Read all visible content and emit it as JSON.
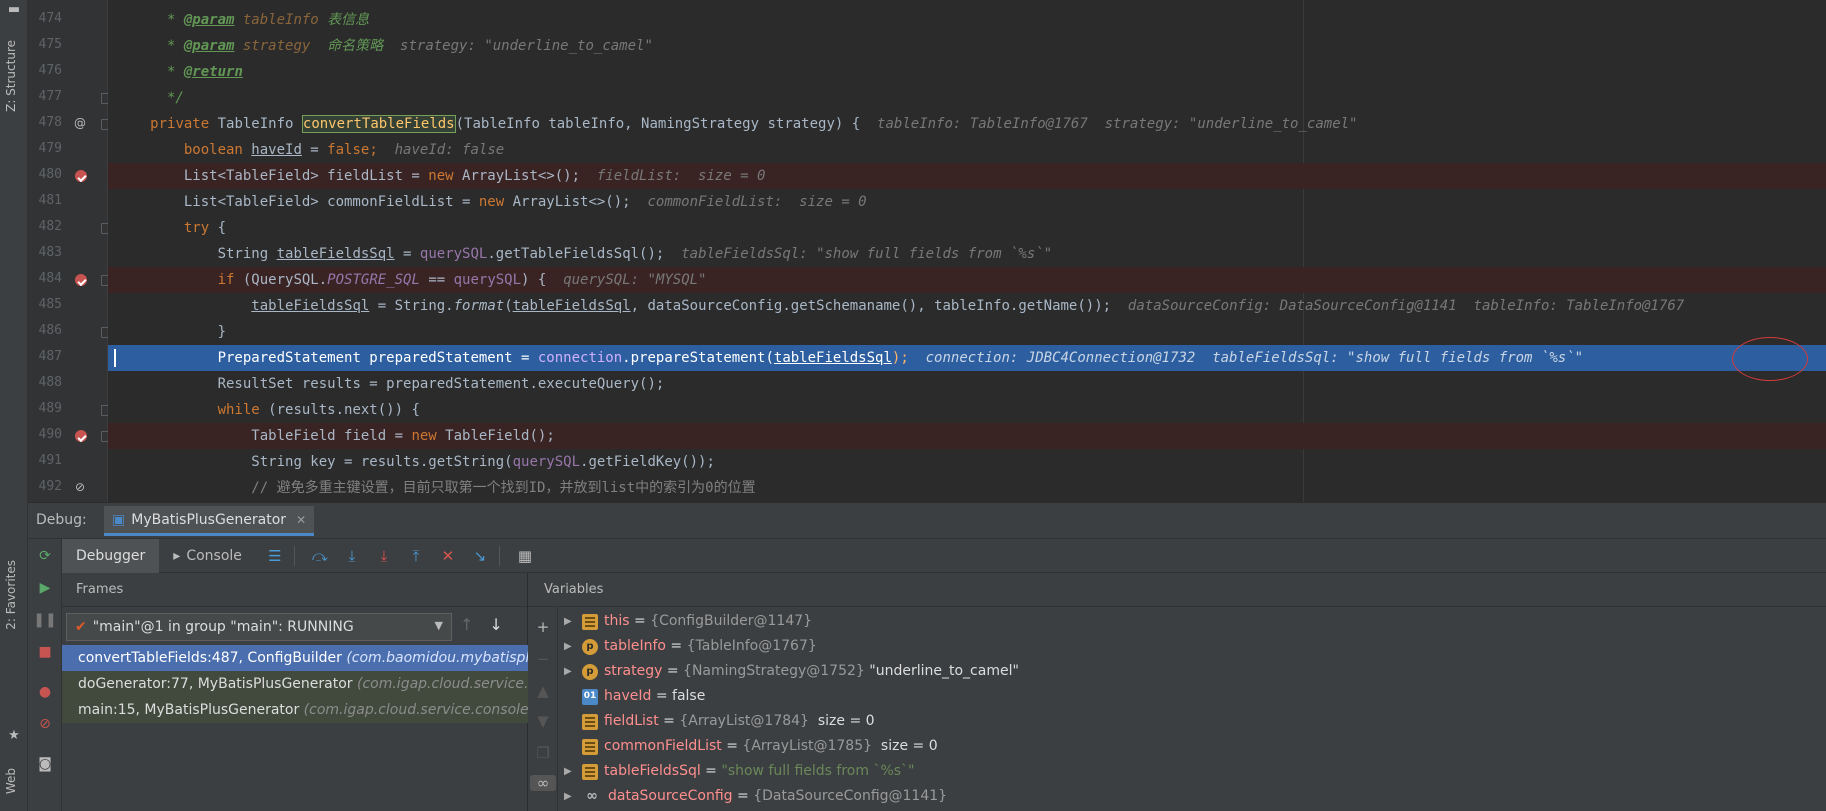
{
  "sidebar": {
    "tabs": [
      "Z: Structure",
      "2: Favorites",
      "Web"
    ]
  },
  "editor": {
    "lines": [
      {
        "n": "474",
        "marker": "",
        "fold": false
      },
      {
        "n": "475",
        "marker": "",
        "fold": false
      },
      {
        "n": "476",
        "marker": "",
        "fold": false
      },
      {
        "n": "477",
        "marker": "",
        "fold": true
      },
      {
        "n": "478",
        "marker": "@",
        "fold": true
      },
      {
        "n": "479",
        "marker": "",
        "fold": false
      },
      {
        "n": "480",
        "marker": "breakpoint",
        "fold": false
      },
      {
        "n": "481",
        "marker": "",
        "fold": false
      },
      {
        "n": "482",
        "marker": "",
        "fold": true
      },
      {
        "n": "483",
        "marker": "",
        "fold": false
      },
      {
        "n": "484",
        "marker": "breakpoint",
        "fold": true
      },
      {
        "n": "485",
        "marker": "",
        "fold": false
      },
      {
        "n": "486",
        "marker": "",
        "fold": true
      },
      {
        "n": "487",
        "marker": "",
        "fold": false
      },
      {
        "n": "488",
        "marker": "",
        "fold": false
      },
      {
        "n": "489",
        "marker": "",
        "fold": true
      },
      {
        "n": "490",
        "marker": "breakpoint",
        "fold": true
      },
      {
        "n": "491",
        "marker": "",
        "fold": false
      },
      {
        "n": "492",
        "marker": "disabled",
        "fold": false
      }
    ],
    "code": {
      "l474": {
        "star": " * ",
        "tag": "@param",
        "param": " tableInfo",
        "text": " 表信息"
      },
      "l475": {
        "star": " * ",
        "tag": "@param",
        "param": " strategy",
        "text": "  命名策略",
        "hint": "  strategy: \"underline_to_camel\""
      },
      "l476": {
        "star": " * ",
        "tag": "@return"
      },
      "l477": {
        "text": " */"
      },
      "l478": {
        "kw": "private ",
        "t1": "TableInfo ",
        "fn": "convertTableFields",
        "rest": "(TableInfo tableInfo, NamingStrategy strategy) {",
        "hint": "  tableInfo: TableInfo@1767  strategy: \"underline_to_camel\""
      },
      "l479": {
        "kw": "boolean ",
        "var": "haveId",
        "rest1": " = ",
        "kw2": "false",
        "rest2": ";",
        "hint": "  haveId: false"
      },
      "l480": {
        "t1": "List<TableField> fieldList = ",
        "kw": "new ",
        "rest": "ArrayList<>();",
        "hint": "  fieldList:  size = 0"
      },
      "l481": {
        "t1": "List<TableField> commonFieldList = ",
        "kw": "new ",
        "rest": "ArrayList<>();",
        "hint": "  commonFieldList:  size = 0"
      },
      "l482": {
        "kw": "try ",
        "rest": "{"
      },
      "l483": {
        "t1": "String ",
        "var": "tableFieldsSql",
        "rest1": " = ",
        "st": "querySQL",
        "rest2": ".getTableFieldsSql();",
        "hint": "  tableFieldsSql: \"show full fields from `%s`\""
      },
      "l484": {
        "kw": "if ",
        "t1": "(QuerySQL.",
        "st": "POSTGRE_SQL",
        "rest1": " == ",
        "st2": "querySQL",
        "rest2": ") {",
        "hint": "  querySQL: \"MYSQL\""
      },
      "l485": {
        "var": "tableFieldsSql",
        "rest1": " = String.",
        "it": "format",
        "rest2": "(",
        "var2": "tableFieldsSql",
        "rest3": ", dataSourceConfig.getSchemaname(), tableInfo.getName());",
        "hint": "  dataSourceConfig: DataSourceConfig@1141  tableInfo: TableInfo@1767"
      },
      "l486": {
        "text": "}"
      },
      "l487": {
        "t1": "PreparedStatement preparedStatement = ",
        "st": "connection",
        "rest1": ".prepareStatement(",
        "var": "tableFieldsSql",
        "rest2": ");",
        "hint": "  connection: JDBC4Connection@1732  tableFieldsSql: \"show full fields from `%s`\""
      },
      "l488": {
        "text": "ResultSet results = preparedStatement.executeQuery();"
      },
      "l489": {
        "kw": "while ",
        "rest": "(results.next()) {"
      },
      "l490": {
        "t1": "TableField field = ",
        "kw": "new ",
        "rest": "TableField();"
      },
      "l491": {
        "t1": "String key = results.getString(",
        "st": "querySQL",
        "rest": ".getFieldKey());"
      },
      "l492": {
        "text": "// 避免多重主键设置，目前只取第一个找到ID，并放到list中的索引为0的位置"
      }
    }
  },
  "debug": {
    "title": "Debug:",
    "session_tab": "MyBatisPlusGenerator",
    "tabs": {
      "debugger": "Debugger",
      "console": "Console"
    },
    "frames": {
      "header": "Frames",
      "thread": "\"main\"@1 in group \"main\": RUNNING",
      "items": [
        {
          "method": "convertTableFields:487, ConfigBuilder",
          "pkg": " (com.baomidou.mybatisplus"
        },
        {
          "method": "doGenerator:77, MyBatisPlusGenerator",
          "pkg": " (com.igap.cloud.service.cons"
        },
        {
          "method": "main:15, MyBatisPlusGenerator",
          "pkg": " (com.igap.cloud.service.console)"
        }
      ]
    },
    "variables": {
      "header": "Variables",
      "items": [
        {
          "icon": "field",
          "expand": true,
          "name": "this",
          "eq": " = ",
          "type": "{ConfigBuilder@1147}",
          "extra": ""
        },
        {
          "icon": "param",
          "expand": true,
          "name": "tableInfo",
          "eq": " = ",
          "type": "{TableInfo@1767}",
          "extra": ""
        },
        {
          "icon": "param",
          "expand": true,
          "name": "strategy",
          "eq": " = ",
          "type": "{NamingStrategy@1752}",
          "extra": " \"underline_to_camel\""
        },
        {
          "icon": "bool",
          "expand": false,
          "name": "haveId",
          "eq": " = ",
          "type": "",
          "extra": "false"
        },
        {
          "icon": "field",
          "expand": false,
          "name": "fieldList",
          "eq": " = ",
          "type": "{ArrayList@1784}",
          "extra": "  size = 0"
        },
        {
          "icon": "field",
          "expand": false,
          "name": "commonFieldList",
          "eq": " = ",
          "type": "{ArrayList@1785}",
          "extra": "  size = 0"
        },
        {
          "icon": "field",
          "expand": true,
          "name": "tableFieldsSql",
          "eq": " = ",
          "type": "",
          "extra": "\"show full fields from `%s`\""
        },
        {
          "icon": "watch",
          "expand": true,
          "name": "dataSourceConfig",
          "eq": " = ",
          "type": "{DataSourceConfig@1141}",
          "extra": ""
        }
      ]
    }
  },
  "colors": {
    "current_line": "#2d5fa0",
    "breakpoint": "#c75450",
    "selected_frame": "#4b6eaf"
  }
}
